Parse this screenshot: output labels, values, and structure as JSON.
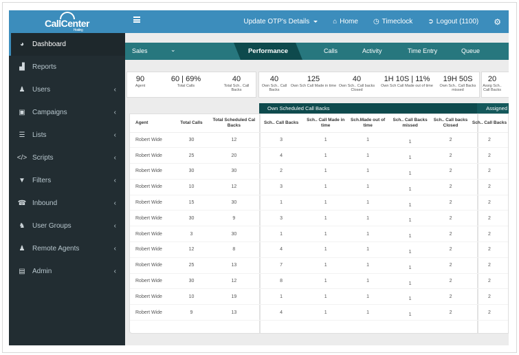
{
  "brand": {
    "name": "CallCenter",
    "sub": "Hosting"
  },
  "colors": {
    "header": "#3c8dbc",
    "sidebar": "#222d32",
    "tabbar": "#27777e",
    "tab_active": "#0e4a4d"
  },
  "sidebar": {
    "items": [
      {
        "label": "Dashboard",
        "icon": "dashboard-icon",
        "glyph": "◕",
        "active": true,
        "chevron": false
      },
      {
        "label": "Reports",
        "icon": "bar-chart-icon",
        "glyph": "▟",
        "active": false,
        "chevron": false
      },
      {
        "label": "Users",
        "icon": "user-plus-icon",
        "glyph": "♟",
        "active": false,
        "chevron": true
      },
      {
        "label": "Campaigns",
        "icon": "campaign-icon",
        "glyph": "▣",
        "active": false,
        "chevron": true
      },
      {
        "label": "Lists",
        "icon": "list-icon",
        "glyph": "☰",
        "active": false,
        "chevron": true
      },
      {
        "label": "Scripts",
        "icon": "code-icon",
        "glyph": "</>",
        "active": false,
        "chevron": true
      },
      {
        "label": "Filters",
        "icon": "filter-icon",
        "glyph": "▼",
        "active": false,
        "chevron": true
      },
      {
        "label": "Inbound",
        "icon": "phone-square-icon",
        "glyph": "☎",
        "active": false,
        "chevron": true
      },
      {
        "label": "User Groups",
        "icon": "users-icon",
        "glyph": "♞",
        "active": false,
        "chevron": true
      },
      {
        "label": "Remote Agents",
        "icon": "user-icon",
        "glyph": "♟",
        "active": false,
        "chevron": true
      },
      {
        "label": "Admin",
        "icon": "lock-icon",
        "glyph": "▤",
        "active": false,
        "chevron": true
      }
    ],
    "chevron_glyph": "‹"
  },
  "topbar": {
    "update": "Update OTP's Details",
    "home": "Home",
    "home_glyph": "⌂",
    "timeclock": "Timeclock",
    "timeclock_glyph": "◷",
    "logout": "Logout (1100)",
    "logout_glyph": "➲",
    "settings_glyph": "⚙"
  },
  "tabs": {
    "dropdown": "Sales",
    "dropdown_glyph": "⌄",
    "active": "Performance",
    "items": [
      "Calls",
      "Activity",
      "Time Entry",
      "Queue"
    ]
  },
  "summary": {
    "left": [
      {
        "value": "90",
        "label": "Agent"
      },
      {
        "value": "60  | 69%",
        "label": "Total Calls"
      },
      {
        "value": "40",
        "label": "Total Sch.. Call Backs"
      }
    ],
    "own": [
      {
        "value": "40",
        "label": "Own Sch.. Call Backs"
      },
      {
        "value": "125",
        "label": "Own Sch Call Made in time"
      },
      {
        "value": "40",
        "label": "Own Sch.. Call backs Closed"
      },
      {
        "value": "1H 10S | 11%",
        "label": "Own Sch Call Made out of time"
      },
      {
        "value": "19H 50S",
        "label": "Own Sch.. Call Backs missed"
      }
    ],
    "assigned": [
      {
        "value": "20",
        "label": "Assig Sch.. Call Backs"
      }
    ]
  },
  "groups": {
    "own": "Own Scheduled Call Backs",
    "assigned": "Assigned"
  },
  "table": {
    "headers": [
      "Agent",
      "Total Calls",
      "Total Scheduled Cal Backs",
      "Sch.. Call Backs",
      "Sch.. Call Made in time",
      "Sch.Made out of time",
      "Sch.. Call Backs missed",
      "Sch.. Call backs Closed",
      "Sch.. Call Backs"
    ],
    "rows": [
      [
        "Robert Wide",
        "30",
        "12",
        "3",
        "1",
        "1",
        "1",
        "2",
        "2"
      ],
      [
        "Robert Wide",
        "25",
        "20",
        "4",
        "1",
        "1",
        "1",
        "2",
        "2"
      ],
      [
        "Robert Wide",
        "30",
        "30",
        "2",
        "1",
        "1",
        "1",
        "2",
        "2"
      ],
      [
        "Robert Wide",
        "10",
        "12",
        "3",
        "1",
        "1",
        "1",
        "2",
        "2"
      ],
      [
        "Robert Wide",
        "15",
        "30",
        "1",
        "1",
        "1",
        "1",
        "2",
        "2"
      ],
      [
        "Robert Wide",
        "30",
        "9",
        "3",
        "1",
        "1",
        "1",
        "2",
        "2"
      ],
      [
        "Robert Wide",
        "3",
        "30",
        "1",
        "1",
        "1",
        "1",
        "2",
        "2"
      ],
      [
        "Robert Wide",
        "12",
        "8",
        "4",
        "1",
        "1",
        "1",
        "2",
        "2"
      ],
      [
        "Robert Wide",
        "25",
        "13",
        "7",
        "1",
        "1",
        "1",
        "2",
        "2"
      ],
      [
        "Robert Wide",
        "30",
        "12",
        "8",
        "1",
        "1",
        "1",
        "2",
        "2"
      ],
      [
        "Robert Wide",
        "10",
        "19",
        "1",
        "1",
        "1",
        "1",
        "2",
        "2"
      ],
      [
        "Robert Wide",
        "9",
        "13",
        "4",
        "1",
        "1",
        "1",
        "2",
        "2"
      ]
    ]
  }
}
